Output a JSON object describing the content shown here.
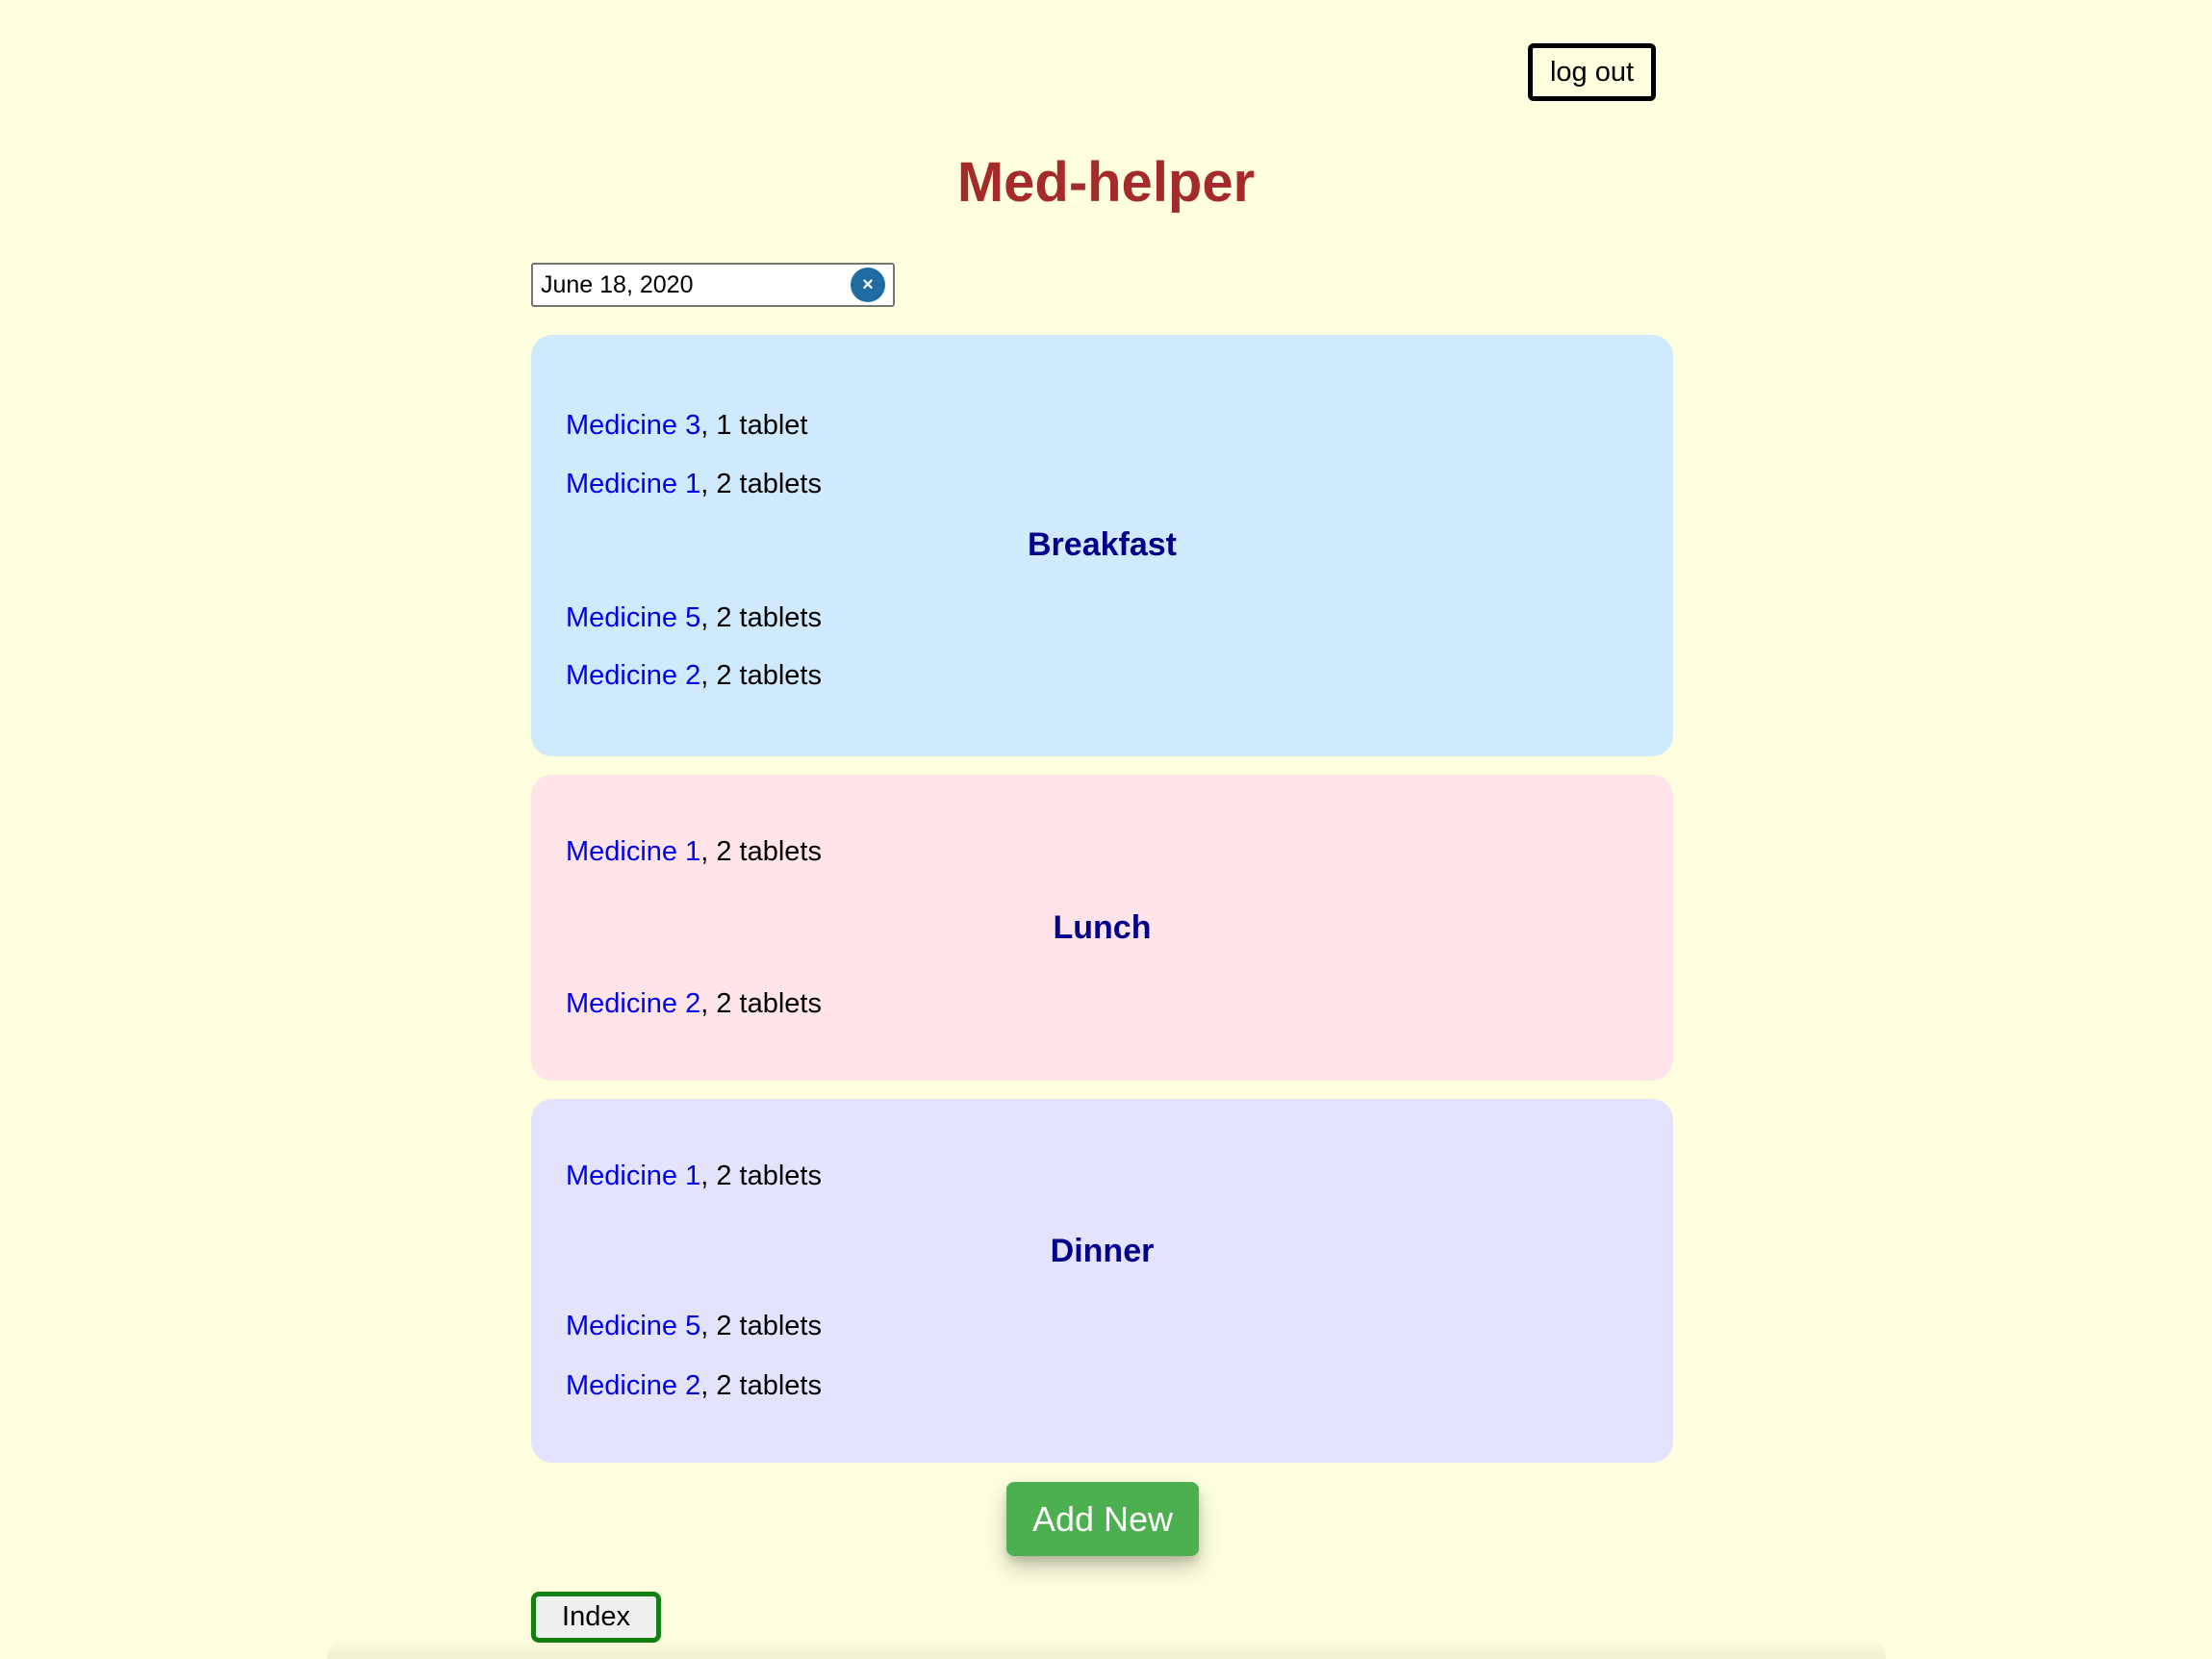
{
  "header": {
    "logout_label": "log out",
    "title": "Med-helper"
  },
  "date_picker": {
    "value": "June 18, 2020",
    "clear_symbol": "×"
  },
  "meals": {
    "breakfast": {
      "title": "Breakfast",
      "before": [
        {
          "name": "Medicine 3",
          "dose": ", 1 tablet"
        },
        {
          "name": "Medicine 1",
          "dose": ", 2 tablets"
        }
      ],
      "after": [
        {
          "name": "Medicine 5",
          "dose": ", 2 tablets"
        },
        {
          "name": "Medicine 2",
          "dose": ", 2 tablets"
        }
      ],
      "color": "#cfeafc"
    },
    "lunch": {
      "title": "Lunch",
      "before": [
        {
          "name": "Medicine 1",
          "dose": ", 2 tablets"
        }
      ],
      "after": [
        {
          "name": "Medicine 2",
          "dose": ", 2 tablets"
        }
      ],
      "color": "#ffe4ea"
    },
    "dinner": {
      "title": "Dinner",
      "before": [
        {
          "name": "Medicine 1",
          "dose": ", 2 tablets"
        }
      ],
      "after": [
        {
          "name": "Medicine 5",
          "dose": ", 2 tablets"
        },
        {
          "name": "Medicine 2",
          "dose": ", 2 tablets"
        }
      ],
      "color": "#e3e3fe"
    }
  },
  "actions": {
    "add_new_label": "Add New",
    "index_label": "Index"
  },
  "colors": {
    "background": "#ffffdf",
    "title": "#a52a2a",
    "meal_title": "#00008b",
    "link": "#0000ee",
    "add_new": "#4caf50",
    "index_border": "#128012"
  }
}
